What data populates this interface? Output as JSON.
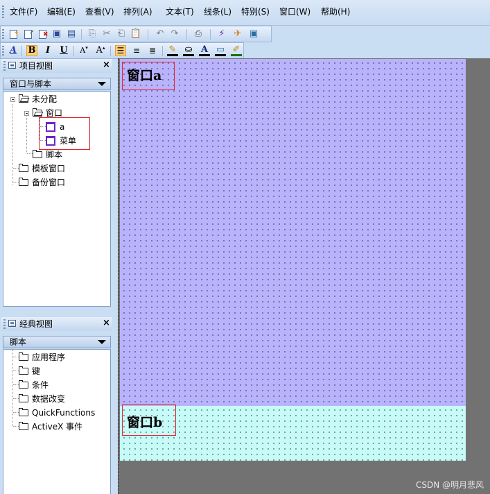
{
  "menu": {
    "items": [
      "文件(F)",
      "编辑(E)",
      "查看(V)",
      "排列(A)",
      "文本(T)",
      "线条(L)",
      "特别(S)",
      "窗口(W)",
      "帮助(H)"
    ]
  },
  "toolbar_standard": {
    "buttons": [
      "new-window",
      "open-window",
      "close-window",
      "save",
      "save-all",
      "copy-disabled",
      "cut-disabled",
      "copy",
      "paste",
      "undo-disabled",
      "redo-disabled",
      "print",
      "toggle-mode",
      "runtime",
      "screen"
    ]
  },
  "toolbar_format": {
    "font_button": "A",
    "bold_label": "B",
    "italic_label": "I",
    "underline_label": "U",
    "shrink_label": "A",
    "grow_label": "A",
    "text_color_label": "A",
    "active_color": "#ffcf7a"
  },
  "project_panel": {
    "title": "项目视图",
    "close": "×",
    "combo_value": "窗口与脚本",
    "tree": {
      "unassigned": "未分配",
      "window_folder": "窗口",
      "window_a": "a",
      "window_menu": "菜单",
      "script": "脚本",
      "template_windows": "模板窗口",
      "backup_windows": "备份窗口"
    }
  },
  "classic_panel": {
    "title": "经典视图",
    "close": "×",
    "combo_value": "脚本",
    "items": [
      "应用程序",
      "键",
      "条件",
      "数据改变",
      "QuickFunctions",
      "ActiveX 事件"
    ]
  },
  "canvas": {
    "window_a_label": "窗口a",
    "window_b_label": "窗口b",
    "window_a_color": "#b8b3fb",
    "window_b_color": "#c7fbf8",
    "workspace_color": "#727272"
  },
  "watermark": "CSDN @明月悲风"
}
